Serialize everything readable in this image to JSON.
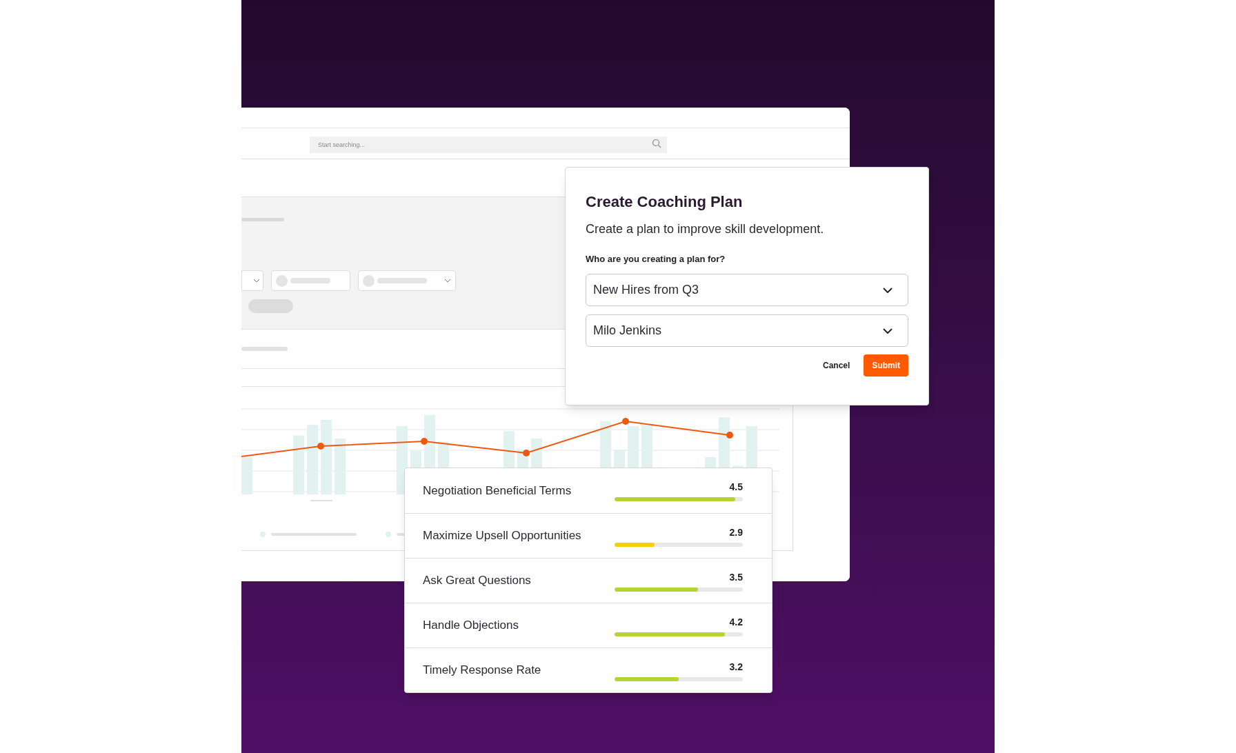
{
  "search": {
    "placeholder": "Start searching..."
  },
  "dialog": {
    "title": "Create Coaching Plan",
    "subtitle": "Create a plan to improve skill development.",
    "question": "Who are you creating a plan for?",
    "selects": [
      {
        "value": "New Hires from Q3"
      },
      {
        "value": "Milo Jenkins"
      }
    ],
    "buttons": [
      {
        "label": "Cancel",
        "kind": "text"
      },
      {
        "label": "Submit",
        "kind": "primary"
      }
    ]
  },
  "skills": [
    {
      "name": "Negotiation Beneficial Terms",
      "score": "4.5",
      "level": 0.94,
      "color": "#b5d334"
    },
    {
      "name": "Maximize Upsell Opportunities",
      "score": "2.9",
      "level": 0.31,
      "color": "#f5cf0a"
    },
    {
      "name": "Ask Great Questions",
      "score": "3.5",
      "level": 0.65,
      "color": "#b5d334"
    },
    {
      "name": "Handle Objections",
      "score": "4.2",
      "level": 0.86,
      "color": "#b5d334"
    },
    {
      "name": "Timely Response Rate",
      "score": "3.2",
      "level": 0.5,
      "color": "#b5d334"
    }
  ]
}
